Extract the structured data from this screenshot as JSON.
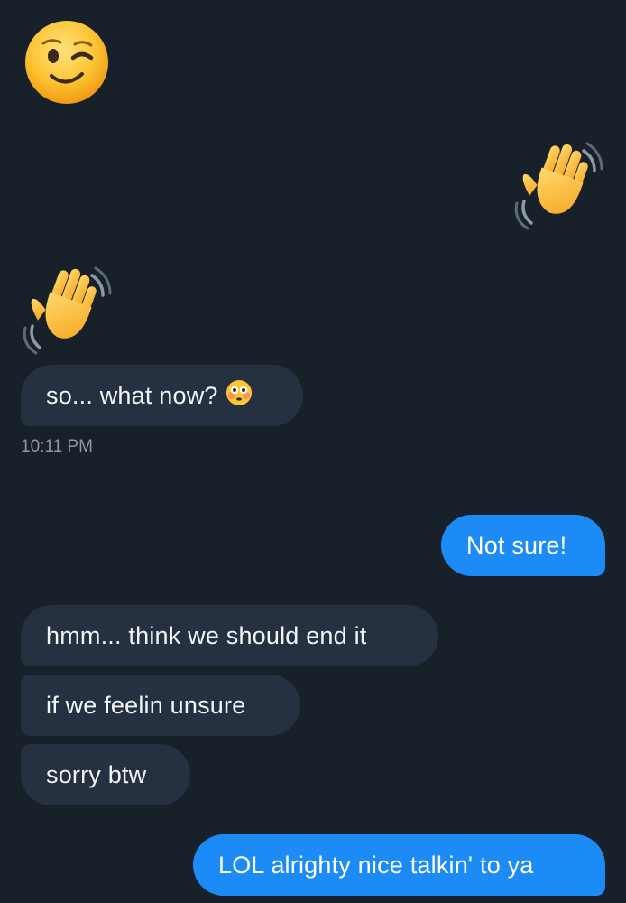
{
  "conversation": {
    "messages": [
      {
        "sender": "them",
        "kind": "emoji",
        "emoji": "winking-face-icon"
      },
      {
        "sender": "me",
        "kind": "emoji",
        "emoji": "waving-hand-icon"
      },
      {
        "sender": "them",
        "kind": "emoji",
        "emoji": "waving-hand-icon"
      },
      {
        "sender": "them",
        "kind": "text",
        "text": "so... what now?",
        "trailing_emoji": "flushed-face-icon"
      },
      {
        "sender": "me",
        "kind": "text",
        "text": "Not sure!"
      },
      {
        "sender": "them",
        "kind": "text",
        "text": "hmm... think we should end it"
      },
      {
        "sender": "them",
        "kind": "text",
        "text": "if we feelin unsure"
      },
      {
        "sender": "them",
        "kind": "text",
        "text": "sorry btw"
      },
      {
        "sender": "me",
        "kind": "text",
        "text": "LOL alrighty nice talkin' to ya"
      }
    ],
    "timestamp": "10:11 PM"
  },
  "colors": {
    "background": "#18202a",
    "incoming_bubble": "#253140",
    "outgoing_bubble": "#1d8bf5",
    "timestamp_text": "#8b98a5"
  }
}
